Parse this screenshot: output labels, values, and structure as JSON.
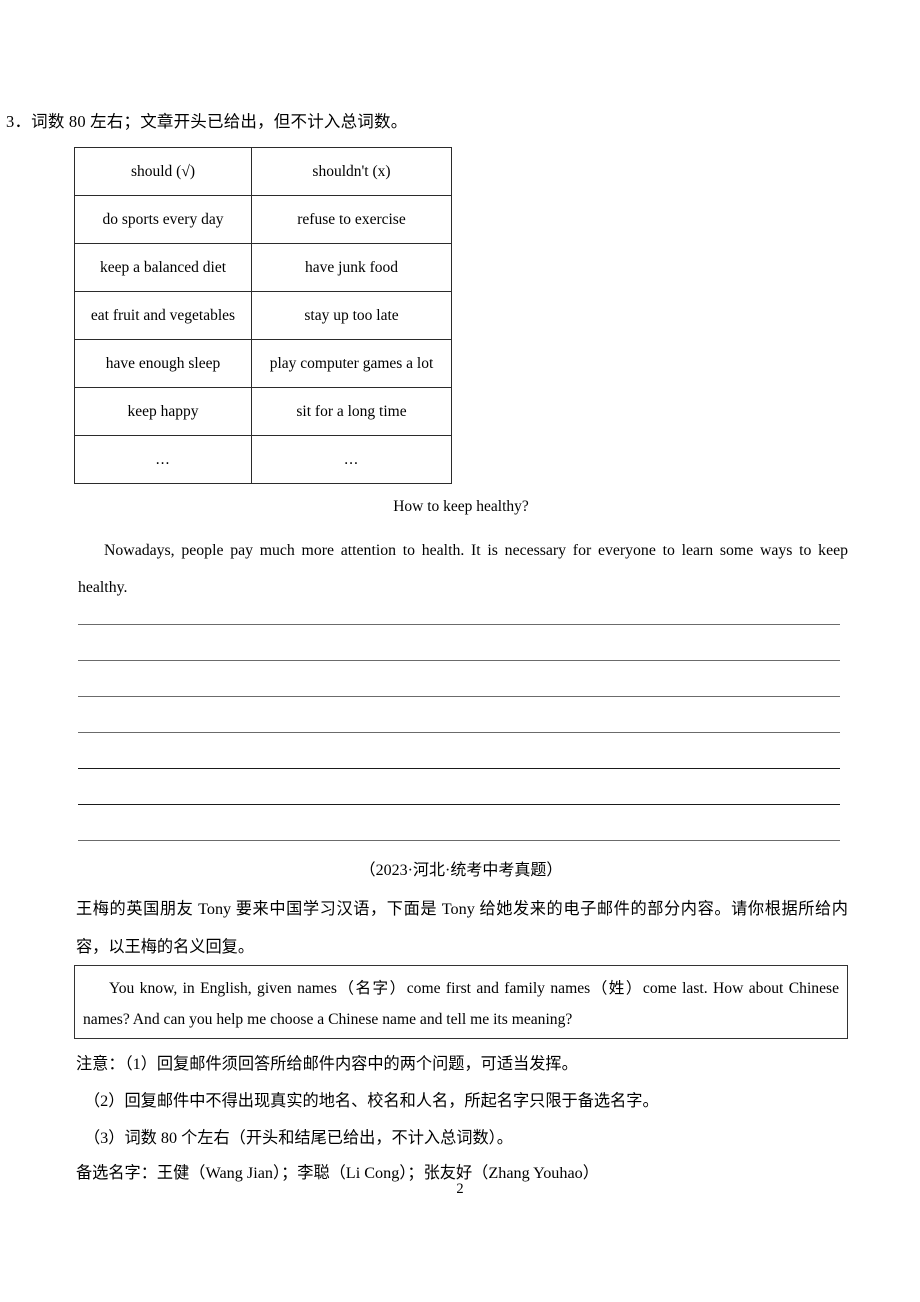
{
  "document": {
    "page_number": "2",
    "requirement_line": "3．词数 80 左右；文章开头已给出，但不计入总词数。"
  },
  "should_table": {
    "headers": [
      "should (√)",
      "shouldn't (x)"
    ],
    "rows": [
      [
        "do sports every day",
        "refuse to exercise"
      ],
      [
        "keep a balanced diet",
        "have junk food"
      ],
      [
        "eat fruit and vegetables",
        "stay up too late"
      ],
      [
        "have enough sleep",
        "play computer games a lot"
      ],
      [
        "keep happy",
        "sit for a long time"
      ],
      [
        "...",
        "..."
      ]
    ]
  },
  "essay": {
    "title": "How to keep healthy?",
    "opening": "Nowadays, people pay much more attention to health. It is necessary for everyone to learn some ways to keep healthy.",
    "answer_line_count": 7
  },
  "question_two": {
    "citation": "（2023·河北·统考中考真题）",
    "prompt": "王梅的英国朋友 Tony 要来中国学习汉语，下面是 Tony 给她发来的电子邮件的部分内容。请你根据所给内容，以王梅的名义回复。",
    "email_excerpt": "You know, in English, given names（名字）come first and family names（姓）come last. How about Chinese names? And can you help me choose a Chinese name and tell me its meaning?",
    "notes": {
      "note_1": "注意：（1）回复邮件须回答所给邮件内容中的两个问题，可适当发挥。",
      "note_2": "（2）回复邮件中不得出现真实的地名、校名和人名，所起名字只限于备选名字。",
      "note_3": "（3）词数 80 个左右（开头和结尾已给出，不计入总词数）。",
      "note_4": "备选名字：王健（Wang Jian）；李聪（Li Cong）；张友好（Zhang Youhao）"
    }
  },
  "colors": {
    "text": "#000000",
    "border": "#2b2b2b",
    "rule": "#6b6b6b",
    "background": "#ffffff"
  }
}
